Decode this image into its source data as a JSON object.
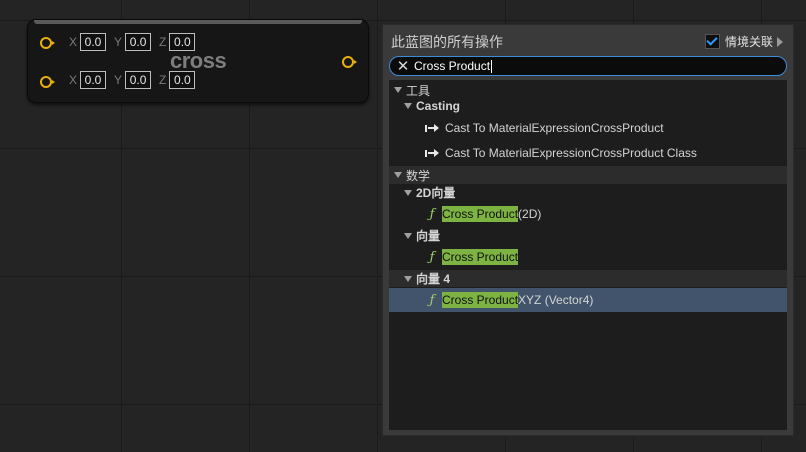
{
  "node": {
    "title": "cross",
    "rows": [
      {
        "x": "0.0",
        "y": "0.0",
        "z": "0.0"
      },
      {
        "x": "0.0",
        "y": "0.0",
        "z": "0.0"
      }
    ],
    "axes": {
      "x": "X",
      "y": "Y",
      "z": "Z"
    },
    "pin_color": "#e8b00a"
  },
  "menu": {
    "title": "此蓝图的所有操作",
    "context_label": "情境关联",
    "context_checked": true,
    "search_value": "Cross Product",
    "highlight_color": "#7cb342",
    "selection_color": "#41546b",
    "tools": {
      "label": "工具",
      "casting": {
        "label": "Casting",
        "items": [
          "Cast To MaterialExpressionCrossProduct",
          "Cast To MaterialExpressionCrossProduct Class"
        ]
      }
    },
    "math": {
      "label": "数学",
      "vector2d": {
        "label": "2D向量",
        "item_match": "Cross Product",
        "item_rest": " (2D)"
      },
      "vector": {
        "label": "向量",
        "item_match": "Cross Product",
        "item_rest": ""
      },
      "vector4": {
        "label": "向量 4",
        "item_match": "Cross Product",
        "item_rest": " XYZ (Vector4)"
      }
    }
  }
}
